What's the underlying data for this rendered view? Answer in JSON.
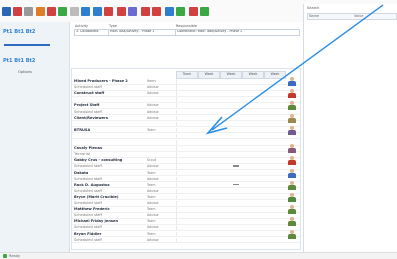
{
  "toolbar": {
    "icons": [
      {
        "name": "save-icon",
        "color": "#2b67b4"
      },
      {
        "name": "doc-icon",
        "color": "#d24141"
      },
      {
        "name": "edit-icon",
        "color": "#999999"
      },
      {
        "name": "copy-icon",
        "color": "#e07d2a"
      },
      {
        "name": "paste-icon",
        "color": "#d24141"
      },
      {
        "name": "cut-icon",
        "color": "#3aa845"
      },
      {
        "name": "refresh-icon",
        "color": "#bbbbbb"
      },
      {
        "name": "people-icon",
        "color": "#2e7fd0"
      },
      {
        "name": "group-icon",
        "color": "#2e7fd0"
      },
      {
        "name": "calendar-icon",
        "color": "#d24141"
      },
      {
        "name": "pin-icon",
        "color": "#d24141"
      },
      {
        "name": "chart-icon",
        "color": "#6c6cd0"
      },
      {
        "name": "network-icon",
        "color": "#d24141"
      },
      {
        "name": "map-icon",
        "color": "#d24141"
      },
      {
        "name": "globe-icon",
        "color": "#2e7fd0"
      },
      {
        "name": "image-icon",
        "color": "#3aa845"
      },
      {
        "name": "flag-icon",
        "color": "#d24141"
      },
      {
        "name": "add-icon",
        "color": "#3aa845"
      }
    ]
  },
  "left_nav": {
    "row1": "Pt1 Bt1 Bt2",
    "row2": "Pt1 Bt1 Bt2",
    "section": "Options"
  },
  "header": {
    "label_a": "Activity",
    "label_b": "Type",
    "label_c": "Responsible",
    "field_a": "3. Collaborate",
    "field_b": "Main Task/Activity - Phase 1",
    "field_c": "Coordinator: Main Task/Activity - Phase 1"
  },
  "grid": {
    "columns": [
      "Team",
      "Week",
      "Week",
      "Week",
      "Week"
    ],
    "rows": [
      {
        "name": "Mixed Producers - Phase 2",
        "value": "Items",
        "style": "bold",
        "avatar": "#3a6dc2"
      },
      {
        "name": "Scheduled staff",
        "value": "Advisor",
        "style": "sub"
      },
      {
        "name": "Construct staff",
        "value": "Advisor",
        "style": "bold",
        "avatar": "#c0392b"
      },
      {
        "name": "",
        "value": "",
        "style": "sub"
      },
      {
        "name": "Project Staff",
        "value": "Advisor",
        "style": "bold",
        "avatar": "#5d8a3a"
      },
      {
        "name": "Scheduled staff",
        "value": "Advisor",
        "style": "sub"
      },
      {
        "name": "Client/Reviewers",
        "value": "Advisor",
        "style": "bold",
        "avatar": "#9a8a50"
      },
      {
        "name": "",
        "value": "",
        "style": "sub"
      },
      {
        "name": "BTRUSA",
        "value": "Team",
        "style": "bold",
        "avatar": "#6f5b8e"
      },
      {
        "name": "",
        "value": "",
        "style": "sub"
      },
      {
        "name": "",
        "value": "",
        "style": "sub"
      },
      {
        "name": "Cavaly Pienas",
        "value": "",
        "style": "bold",
        "avatar": "#8a5a7a"
      },
      {
        "name": "Tecnorial",
        "value": "",
        "style": "sub"
      },
      {
        "name": "Gabby Crus - consulting",
        "value": "Scout",
        "style": "bold",
        "avatar": "#c0392b"
      },
      {
        "name": "Scheduled staff",
        "value": "Advisor",
        "style": "sub",
        "tick": true
      },
      {
        "name": "Dakota",
        "value": "Team",
        "style": "bold",
        "avatar": "#3a6dc2"
      },
      {
        "name": "Scheduled staff",
        "value": "Advisor",
        "style": "sub"
      },
      {
        "name": "Rock D. Augustus",
        "value": "Team",
        "style": "bold",
        "avatar": "#5d8a3a",
        "tick": true
      },
      {
        "name": "Scheduled staff",
        "value": "Advisor",
        "style": "sub"
      },
      {
        "name": "Bryce (Marti Crucible)",
        "value": "Team",
        "style": "bold",
        "avatar": "#4f8a3a"
      },
      {
        "name": "Scheduled staff",
        "value": "Advisor",
        "style": "sub"
      },
      {
        "name": "Matthew Frederic",
        "value": "Team",
        "style": "bold",
        "avatar": "#5d8a3a"
      },
      {
        "name": "Scheduled staff",
        "value": "Advisor",
        "style": "sub"
      },
      {
        "name": "Michael Friday Jensen",
        "value": "Team",
        "style": "bold",
        "avatar": "#5d8a3a"
      },
      {
        "name": "Scheduled staff",
        "value": "Advisor",
        "style": "sub"
      },
      {
        "name": "Bryan Fiddler",
        "value": "Team",
        "style": "bold",
        "avatar": "#5d8a3a"
      },
      {
        "name": "Scheduled staff",
        "value": "Advisor",
        "style": "sub"
      }
    ]
  },
  "right_panel": {
    "title": "Search",
    "col_a": "Name",
    "col_b": "Value"
  },
  "status": {
    "text": "Ready"
  }
}
